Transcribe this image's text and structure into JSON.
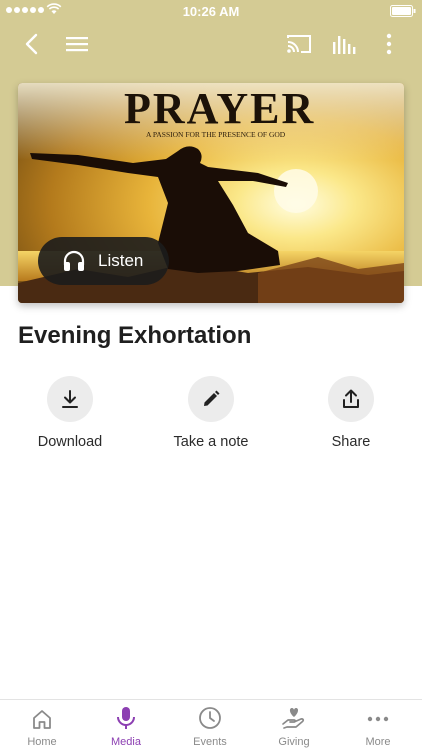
{
  "status_bar": {
    "time": "10:26 AM"
  },
  "hero": {
    "image_heading": "PRAYER",
    "image_tagline": "A PASSION FOR THE PRESENCE OF GOD",
    "listen_label": "Listen"
  },
  "media": {
    "title": "Evening Exhortation"
  },
  "actions": [
    {
      "label": "Download",
      "icon": "download-icon"
    },
    {
      "label": "Take a note",
      "icon": "pencil-icon"
    },
    {
      "label": "Share",
      "icon": "share-icon"
    }
  ],
  "tabs": [
    {
      "label": "Home",
      "icon": "home-icon",
      "active": false
    },
    {
      "label": "Media",
      "icon": "microphone-icon",
      "active": true
    },
    {
      "label": "Events",
      "icon": "clock-icon",
      "active": false
    },
    {
      "label": "Giving",
      "icon": "giving-hand-icon",
      "active": false
    },
    {
      "label": "More",
      "icon": "more-dots-icon",
      "active": false
    }
  ],
  "colors": {
    "header_background": "#d4cb94",
    "active_tab": "#8c3fb2",
    "inactive_tab": "#8a8a8a"
  }
}
